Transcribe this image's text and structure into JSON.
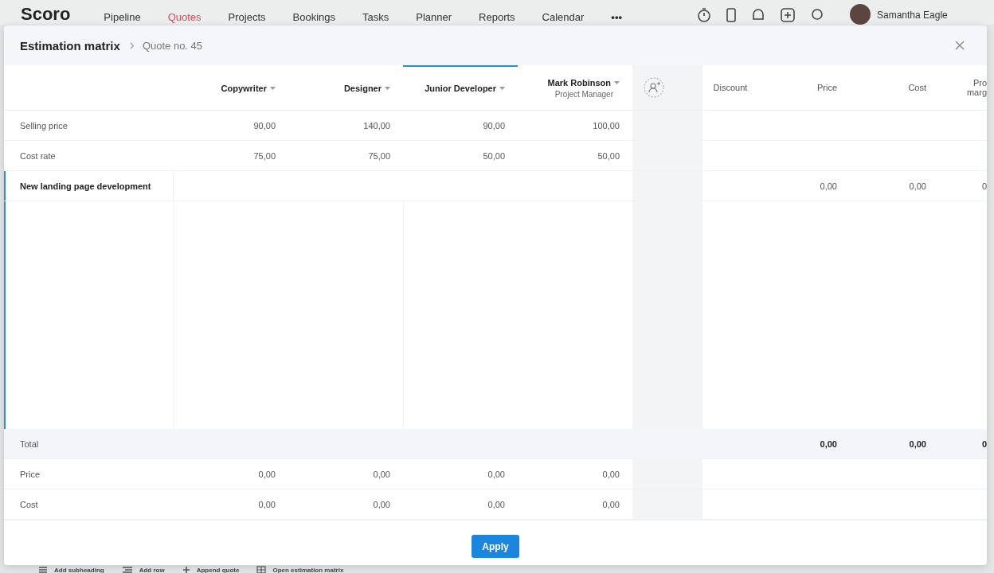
{
  "app_nav": {
    "logo": "Scoro",
    "items": [
      {
        "label": "Pipeline",
        "selected": false
      },
      {
        "label": "Quotes",
        "selected": true
      },
      {
        "label": "Projects",
        "selected": false
      },
      {
        "label": "Bookings",
        "selected": false
      },
      {
        "label": "Tasks",
        "selected": false
      },
      {
        "label": "Planner",
        "selected": false
      },
      {
        "label": "Reports",
        "selected": false
      },
      {
        "label": "Calendar",
        "selected": false
      }
    ],
    "more": "•••",
    "user": "Samantha Eagle"
  },
  "modal": {
    "title": "Estimation matrix",
    "breadcrumb": "Quote no. 45"
  },
  "roles": [
    {
      "name": "Copywriter",
      "selected": false
    },
    {
      "name": "Designer",
      "selected": false
    },
    {
      "name": "Junior Developer",
      "selected": true
    },
    {
      "name": "Mark Robinson",
      "subtitle": "Project Manager",
      "selected": false
    }
  ],
  "summary_columns": [
    {
      "lines": [
        "Discount"
      ]
    },
    {
      "lines": [
        "Price"
      ]
    },
    {
      "lines": [
        "Cost"
      ]
    },
    {
      "lines": [
        "Pro",
        "marg"
      ]
    }
  ],
  "rate_rows": [
    {
      "label": "Selling price",
      "values": [
        "90,00",
        "140,00",
        "90,00",
        "100,00"
      ]
    },
    {
      "label": "Cost rate",
      "values": [
        "75,00",
        "75,00",
        "50,00",
        "50,00"
      ]
    }
  ],
  "task_rows": [
    {
      "label": "New landing page development",
      "selected": true,
      "summary_values": [
        "0,00",
        "0,00",
        "0"
      ]
    }
  ],
  "total": {
    "label": "Total",
    "summary_values": [
      "0,00",
      "0,00",
      "0"
    ]
  },
  "totals_rows": [
    {
      "label": "Price",
      "values": [
        "0,00",
        "0,00",
        "0,00",
        "0,00"
      ]
    },
    {
      "label": "Cost",
      "values": [
        "0,00",
        "0,00",
        "0,00",
        "0,00"
      ]
    }
  ],
  "apply_button": "Apply",
  "toolbar": [
    {
      "kind": "subheading",
      "label": "Add subheading"
    },
    {
      "kind": "row",
      "label": "Add row"
    },
    {
      "kind": "append",
      "label": "Append quote"
    },
    {
      "kind": "matrix",
      "label": "Open estimation matrix"
    }
  ]
}
